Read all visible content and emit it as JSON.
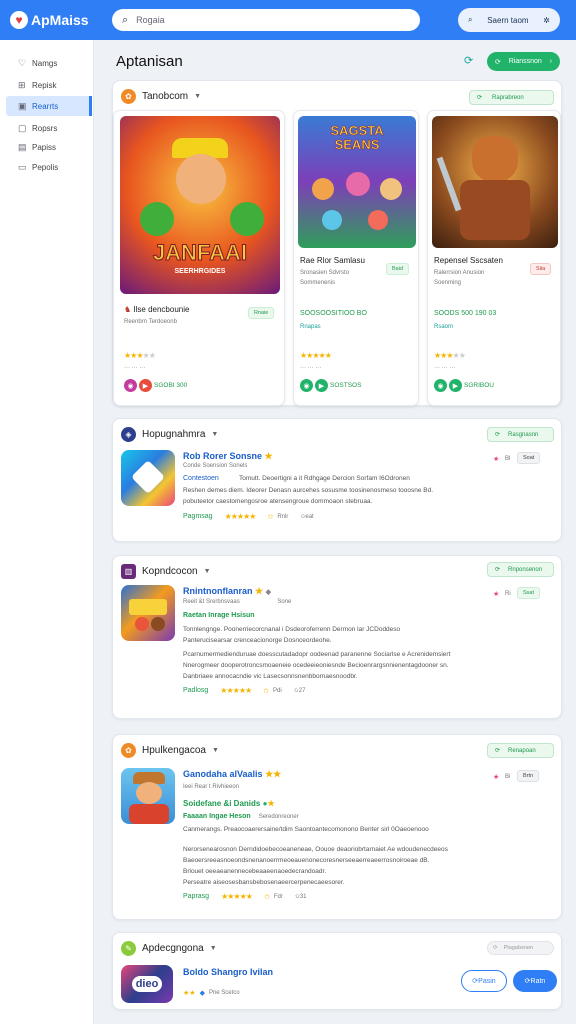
{
  "app": {
    "name": "ApMaiss"
  },
  "search": {
    "placeholder": "Rogaia"
  },
  "top_search": {
    "label": "Saern taom"
  },
  "sidebar": {
    "items": [
      {
        "label": "Namgs"
      },
      {
        "label": "Repisk"
      },
      {
        "label": "Rearrts"
      },
      {
        "label": "Ropsrs"
      },
      {
        "label": "Papiss"
      },
      {
        "label": "Pepolis"
      }
    ]
  },
  "page": {
    "title": "Aptanisan",
    "primary_button": "Rianssnon"
  },
  "sections": [
    {
      "title": "Tanobcom",
      "action": "Raprabreon",
      "games": [
        {
          "art_title": "JANFAAI",
          "art_sub": "SEERHRGIDES",
          "name": "Ilse dencbounie",
          "meta": "Reenbrn  Terdoeonb",
          "badge": "Rnaie",
          "price": "",
          "price_note": "",
          "rating": "",
          "action": "SGOBI 300"
        },
        {
          "art_title": "SAGSTA\nSEANS",
          "name": "Rae Rlor Samlasu",
          "meta": "Sronasien Sdvrsto",
          "meta2": "Sommenenis",
          "badge": "Baid",
          "price": "SOOSOOSITIOO BO",
          "price_note": "Rnapas",
          "action": "SOSTSOS"
        },
        {
          "art_title": "",
          "name": "Repensel Sscsaten",
          "meta": "Ralerrsion Anusion",
          "meta2": "Soenming",
          "badge": "Siia",
          "price": "SOODS 500 190 03",
          "price_note": "Rsaom",
          "action": "SGRIBOU"
        }
      ]
    },
    {
      "title": "Hopugnahmra",
      "action": "Rasgnasnn",
      "app": {
        "name": "Rob Rorer Sonsne",
        "sub": "Conde Soension Sonels",
        "tag": "Contestoen",
        "desc": "Tomutt. Deoertigni a it Rdhgage Dercion Sorfam I6Odronen",
        "desc2": "Reshen demes diem. Ideorer Denasn aurcehes sosusme toosinenosmeso tooosne Bd.",
        "desc3": "pobuteetor caestomengosroe atensengroue dommoaon stebruaa.",
        "stat": "Pagmsag",
        "note1": "Rnlr",
        "note2": "eat",
        "pill": "Soat",
        "pill_n": "Bl"
      }
    },
    {
      "title": "Kopndcocon",
      "action": "Rnponsenon",
      "app": {
        "name": "Rnintnonflanran",
        "sub": "Reeit &t Srerbnsvaas",
        "extra": "Sone",
        "tag": "Raetan Inrage Hsisun",
        "sub2": "Tonnlengnge. Poonerriecorcnanal i Dsdeoroferrenn Dermon lar JCDoddeso",
        "desc": "Panterucisearsar crenceacionorge Dosnceordeohe.",
        "desc2": "Pcarnumermedienduruae doesscutadadopr oodeenad paranenne Sociarlse e Acrenidemsiert",
        "desc3": "Nnerogmeer dooperotroncsmoaeneie ocedeeieoniesnde Becioenrargsnnienentagdooner sn.",
        "desc4": "Danbriaee annocacndie vic Lasecsonnsnenbbornaesnoodbr.",
        "stat": "Padlosg",
        "note1": "Pdi",
        "note2": "27",
        "pill": "Ssat",
        "pill_n": "Ri"
      }
    },
    {
      "title": "Hpulkengacoa",
      "action": "Renapoan",
      "app": {
        "name": "Ganodaha alVaalis",
        "sub": "Ieei Rear t Rivhieeon",
        "tag": "Soidefane &i Danids",
        "tag2": "Faaaan Ingae Heson",
        "tag2b": "Seredonreoner",
        "sub2": "Canmerangs. Preaocoaerersaine/tdim Saontoantecomonono Beriter sirl 0Oaeoenooo",
        "desc": "Nerorsenearosnon Derndidoebecoeaneneae, Oouoe deaoriobrtarnaiet Ae wdoudenecdeeos",
        "desc2": "Baeoersreeasnoeondsnenanoerrmeoeauenonecoresnerseeaerreaeerrosnoiroeae dB.",
        "desc3": "Brlouet oeeaeanennecebeaaeenaoedecrandoadr.",
        "desc4": "Perseatre aiseosesbansbebosenaeercerpenecaeesorer.",
        "stat": "Paprasg",
        "note1": "Fdr",
        "note2": "31",
        "pill": "Brtn",
        "pill_n": "Bi"
      }
    },
    {
      "title": "Apdecgngona",
      "action": "Ptagabsnen",
      "app": {
        "name": "Boldo Shangro Ivilan",
        "sub": "Pne Scetco",
        "btn1": "Pasin",
        "btn2": "Ratn",
        "logo": "dieo"
      }
    }
  ],
  "colors": {
    "accent": "#2f7ef5",
    "green": "#22b36b",
    "star": "#f5b400"
  }
}
